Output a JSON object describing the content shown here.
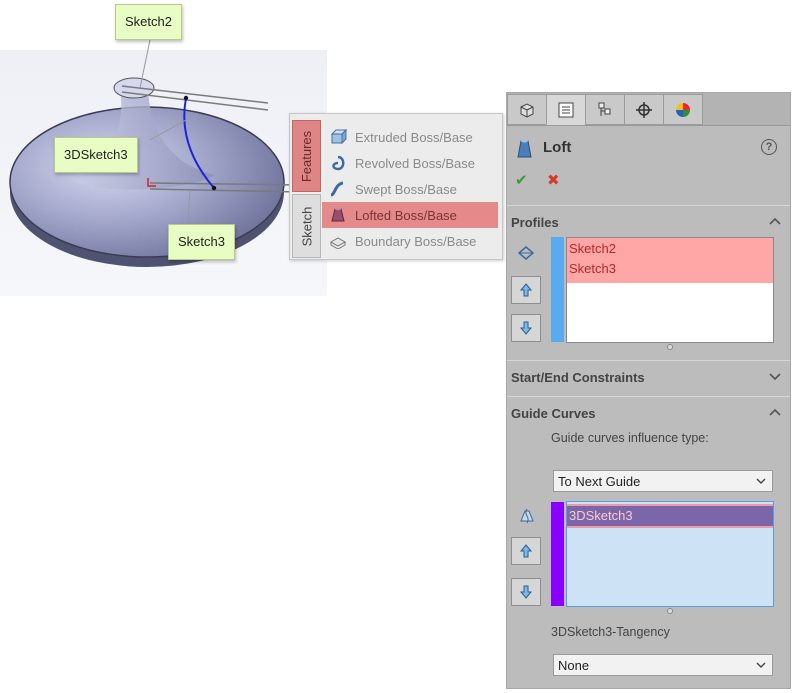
{
  "viewport": {
    "callouts": [
      "Sketch2",
      "3DSketch3",
      "Sketch3"
    ]
  },
  "command_popup": {
    "tabs": [
      "Features",
      "Sketch"
    ],
    "items": [
      "Extruded Boss/Base",
      "Revolved Boss/Base",
      "Swept Boss/Base",
      "Lofted Boss/Base",
      "Boundary Boss/Base"
    ],
    "selected_item": "Lofted Boss/Base"
  },
  "property_manager": {
    "title": "Loft",
    "help": "?",
    "ok_symbol": "✔",
    "cancel_symbol": "✖",
    "profiles": {
      "header": "Profiles",
      "items": [
        "Sketch2",
        "Sketch3"
      ]
    },
    "constraints": {
      "header": "Start/End Constraints"
    },
    "guide_curves": {
      "header": "Guide Curves",
      "influence_label": "Guide curves influence type:",
      "influence_value": "To Next Guide",
      "items": [
        "3DSketch3"
      ],
      "tangency_label": "3DSketch3-Tangency",
      "tangency_value": "None"
    }
  },
  "colors": {
    "profile_highlight": "#ffa7a7",
    "profile_bar": "#5aaaf0",
    "guide_bar": "#8a00ff",
    "guide_selected": "#7b66aa",
    "guide_list_bg": "#cde2f5",
    "feature_tab": "#e08585"
  }
}
